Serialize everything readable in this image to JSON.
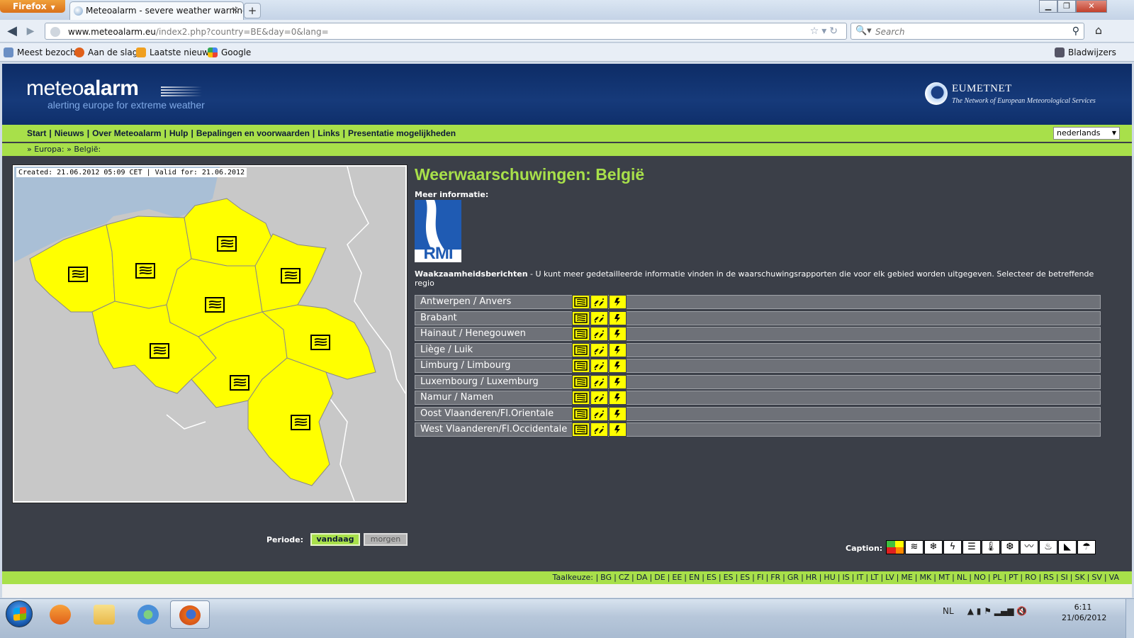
{
  "browser": {
    "app_button": "Firefox",
    "tab_title": "Meteoalarm - severe weather warnings f...",
    "url_host": "www.meteoalarm.eu",
    "url_path": "/index2.php?country=BE&day=0&lang=",
    "search_placeholder": "Search",
    "bookmarks": [
      "Meest bezocht",
      "Aan de slag",
      "Laatste nieuws",
      "Google"
    ],
    "bookmarks_folder": "Bladwijzers"
  },
  "header": {
    "logo_light": "meteo",
    "logo_bold": "alarm",
    "tagline": "alerting europe for extreme weather",
    "partner_name": "EUMETNET",
    "partner_tagline": "The Network of European Meteorological Services"
  },
  "menu": {
    "items": [
      "Start",
      "Nieuws",
      "Over Meteoalarm",
      "Hulp",
      "Bepalingen en voorwaarden",
      "Links",
      "Presentatie mogelijkheden"
    ],
    "language_selected": "nederlands"
  },
  "breadcrumb": {
    "items": [
      "Europa:",
      "België:"
    ]
  },
  "map": {
    "caption": "Created: 21.06.2012 05:09 CET | Valid for: 21.06.2012",
    "region_fill": "#ffff00",
    "land_fill": "#c8c8c8",
    "sea_fill": "#a9bfd6"
  },
  "content": {
    "title": "Weerwaarschuwingen: België",
    "more_info_label": "Meer informatie:",
    "rmi_logo_text": "RMI",
    "intro_bold": "Waakzaamheidsberichten",
    "intro_text": " - U kunt meer gedetailleerde informatie vinden in de waarschuwingsrapporten die voor elk gebied worden uitgegeven. Selecteer de betreffende regio",
    "regions": [
      {
        "name": "Antwerpen / Anvers",
        "icons": [
          "wind-icon",
          "thunderstorm-icon",
          "lightning-icon"
        ]
      },
      {
        "name": "Brabant",
        "icons": [
          "wind-icon",
          "thunderstorm-icon",
          "lightning-icon"
        ]
      },
      {
        "name": "Hainaut / Henegouwen",
        "icons": [
          "wind-icon",
          "thunderstorm-icon",
          "lightning-icon"
        ]
      },
      {
        "name": "Liège / Luik",
        "icons": [
          "wind-icon",
          "thunderstorm-icon",
          "lightning-icon"
        ]
      },
      {
        "name": "Limburg / Limbourg",
        "icons": [
          "wind-icon",
          "thunderstorm-icon",
          "lightning-icon"
        ]
      },
      {
        "name": "Luxembourg / Luxemburg",
        "icons": [
          "wind-icon",
          "thunderstorm-icon",
          "lightning-icon"
        ]
      },
      {
        "name": "Namur / Namen",
        "icons": [
          "wind-icon",
          "thunderstorm-icon",
          "lightning-icon"
        ]
      },
      {
        "name": "Oost Vlaanderen/Fl.Orientale",
        "icons": [
          "wind-icon",
          "thunderstorm-icon",
          "lightning-icon"
        ]
      },
      {
        "name": "West Vlaanderen/Fl.Occidentale",
        "icons": [
          "wind-icon",
          "thunderstorm-icon",
          "lightning-icon"
        ]
      }
    ],
    "warning_color": "#ffff00"
  },
  "period": {
    "label": "Periode:",
    "today": "vandaag",
    "tomorrow": "morgen"
  },
  "caption": {
    "label": "Caption:",
    "icons": [
      "levels-icon",
      "wind-icon",
      "snow-ice-icon",
      "lightning-icon",
      "fog-icon",
      "high-temperature-icon",
      "low-temperature-icon",
      "coastal-event-icon",
      "forest-fire-icon",
      "avalanche-icon",
      "rain-icon"
    ]
  },
  "footer": {
    "label": "Taalkeuze:",
    "languages": [
      "BG",
      "CZ",
      "DA",
      "DE",
      "EE",
      "EN",
      "ES",
      "ES",
      "ES",
      "FI",
      "FR",
      "GR",
      "HR",
      "HU",
      "IS",
      "IT",
      "LT",
      "LV",
      "ME",
      "MK",
      "MT",
      "NL",
      "NO",
      "PL",
      "PT",
      "RO",
      "RS",
      "SI",
      "SK",
      "SV",
      "VA"
    ]
  },
  "taskbar": {
    "language": "NL",
    "time": "6:11",
    "date": "21/06/2012"
  },
  "colors": {
    "accent_green": "#a8e04a",
    "header_blue": "#163a7a",
    "page_bg": "#3b3f48"
  }
}
